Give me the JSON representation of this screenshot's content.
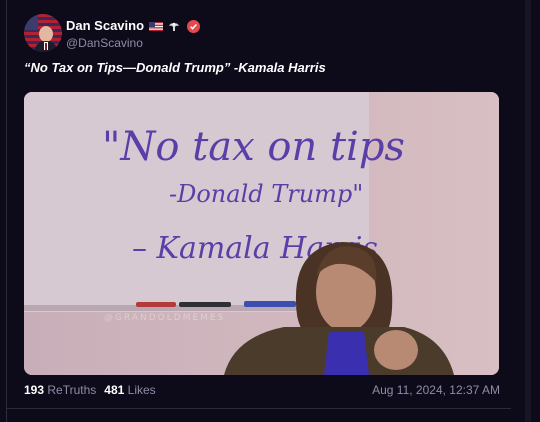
{
  "post": {
    "author_name": "Dan Scavino",
    "author_handle": "@DanScavino",
    "text": "“No Tax on Tips—Donald Trump” -Kamala Harris",
    "image": {
      "whiteboard_lines": [
        "\"No tax on tips",
        "-Donald Trump\"",
        "– Kamala Harris"
      ],
      "watermark": "@GRANDOLDMEMES"
    },
    "retruths_count": "193",
    "retruths_label": "ReTruths",
    "likes_count": "481",
    "likes_label": "Likes",
    "timestamp": "Aug 11, 2024, 12:37 AM"
  },
  "icons": {
    "flag": "us-flag-icon",
    "eagle": "eagle-icon",
    "verified": "verified-badge-icon"
  },
  "colors": {
    "background": "#0d0b1a",
    "muted_text": "#8f8ca6",
    "verified_badge": "#e5484d",
    "marker_ink": "#5a3fa8"
  }
}
